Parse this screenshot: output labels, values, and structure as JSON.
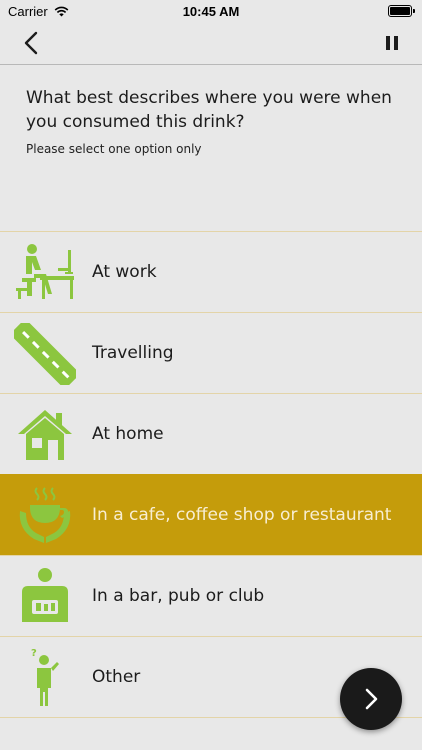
{
  "status_bar": {
    "carrier": "Carrier",
    "time": "10:45 AM"
  },
  "question": {
    "text": "What best describes where you were when you consumed this drink?",
    "hint": "Please select one option only"
  },
  "options": [
    {
      "label": "At work",
      "icon": "desk-worker-icon",
      "selected": false
    },
    {
      "label": "Travelling",
      "icon": "road-icon",
      "selected": false
    },
    {
      "label": "At home",
      "icon": "house-icon",
      "selected": false
    },
    {
      "label": "In a cafe, coffee shop or restaurant",
      "icon": "hot-drink-hands-icon",
      "selected": true
    },
    {
      "label": "In a bar, pub or club",
      "icon": "bartender-icon",
      "selected": false
    },
    {
      "label": "Other",
      "icon": "person-question-icon",
      "selected": false
    }
  ],
  "colors": {
    "accent_green": "#8cc63f",
    "selected_gold": "#c59c0b",
    "background": "#e8e8e8"
  }
}
